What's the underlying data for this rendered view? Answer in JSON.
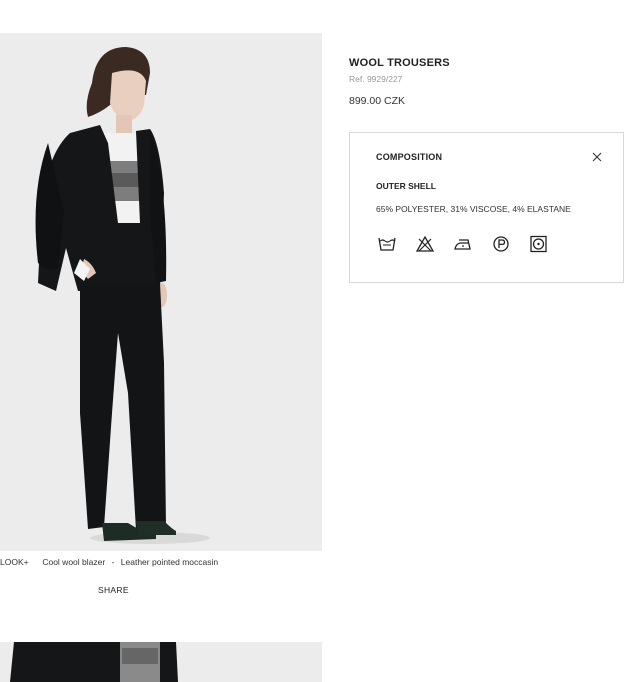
{
  "product": {
    "name": "WOOL TROUSERS",
    "ref": "Ref. 9929/227",
    "price": "899.00 CZK"
  },
  "look": {
    "label": "LOOK+",
    "items": [
      "Cool wool blazer",
      "Leather pointed moccasin"
    ],
    "separator": "-"
  },
  "share_label": "SHARE",
  "composition": {
    "title": "COMPOSITION",
    "section": "OUTER SHELL",
    "materials": "65% POLYESTER, 31% VISCOSE, 4% ELASTANE",
    "care_icons": [
      "wash-30-icon",
      "do-not-bleach-icon",
      "iron-low-icon",
      "dry-clean-p-icon",
      "tumble-dry-icon"
    ]
  }
}
